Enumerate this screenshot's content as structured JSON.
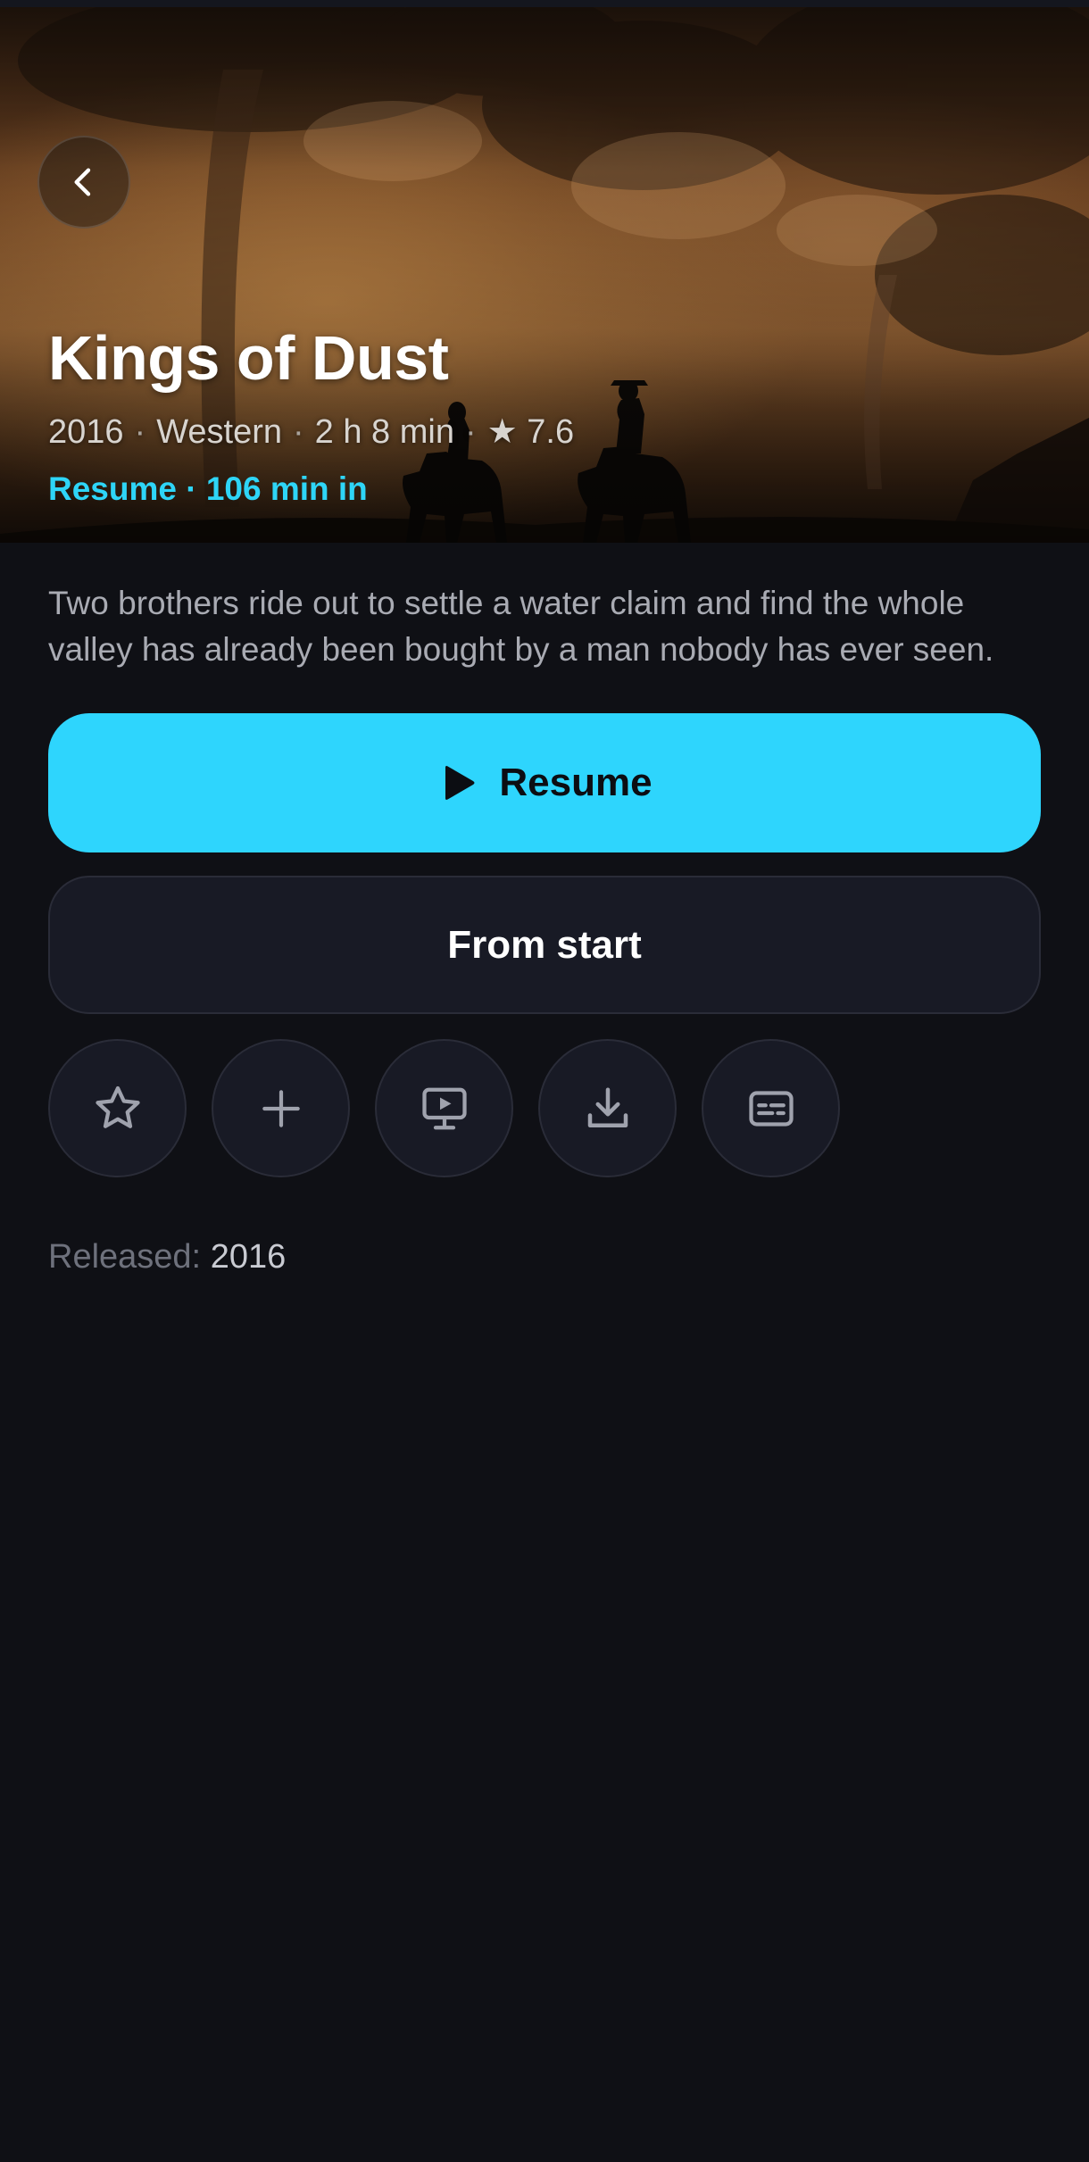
{
  "movie": {
    "title": "Kings of Dust",
    "year": "2016",
    "genre": "Western",
    "duration": "2 h 8 min",
    "rating": "★ 7.6",
    "progress_text": "Resume · 106 min in",
    "synopsis": "Two brothers ride out to settle a water claim and find the whole valley has already been bought by a man nobody has ever seen."
  },
  "meta_separator": "·",
  "buttons": {
    "resume_label": "Resume",
    "from_start_label": "From start"
  },
  "actions": [
    {
      "icon": "star-icon"
    },
    {
      "icon": "plus-icon"
    },
    {
      "icon": "cast-screen-icon"
    },
    {
      "icon": "download-icon"
    },
    {
      "icon": "subtitles-icon"
    }
  ],
  "details": {
    "released_label": "Released:",
    "released_value": "2016"
  },
  "colors": {
    "background": "#0f1015",
    "accent": "#2ed5fd",
    "surface": "#181a25",
    "title": "#ffffff",
    "muted_text": "#a9abb3"
  }
}
